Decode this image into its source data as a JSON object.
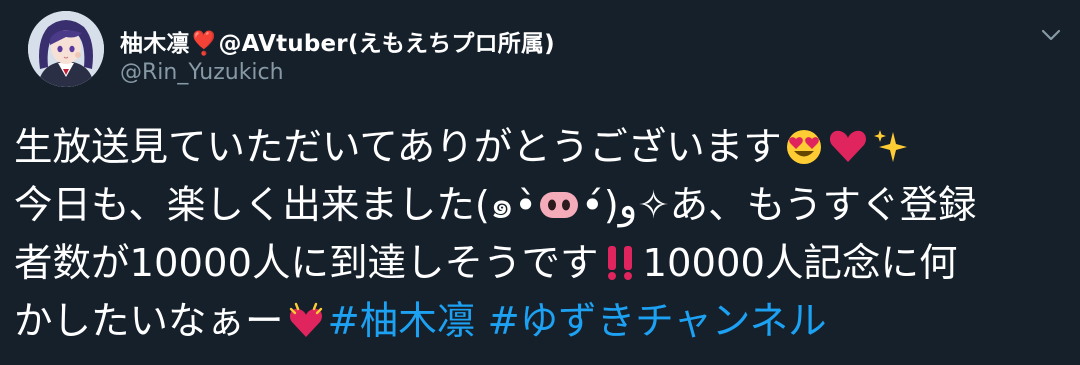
{
  "author": {
    "display_name": "柚木凛❣️@AVtuber(えもえちプロ所属)",
    "handle": "@Rin_Yuzukich"
  },
  "icons": {
    "avatar": "avatar",
    "more": "chevron-down-icon"
  },
  "tweet": {
    "line1": {
      "text": "生放送見ていただいてありがとうございます",
      "emojis": [
        "heart-eyes-emoji",
        "red-heart-emoji",
        "sparkles-emoji"
      ]
    },
    "line2": {
      "text_a": "今日も、楽しく出来ました(๑•̀",
      "text_b": "•́)و✧あ、もうすぐ登録",
      "emoji": "pig-nose-emoji"
    },
    "line3": {
      "text_a": "者数が10000人に到達しそうです",
      "emoji": "double-exclamation-emoji",
      "text_b": "10000人記念に何"
    },
    "line4": {
      "text": "かしたいなぁー",
      "emoji": "ringing-heart-emoji"
    },
    "hashtags": [
      "#柚木凛",
      "#ゆずきチャンネル"
    ]
  },
  "colors": {
    "background": "#15202b",
    "text": "#ffffff",
    "secondary_text": "#8899a6",
    "link": "#1da1f2"
  }
}
